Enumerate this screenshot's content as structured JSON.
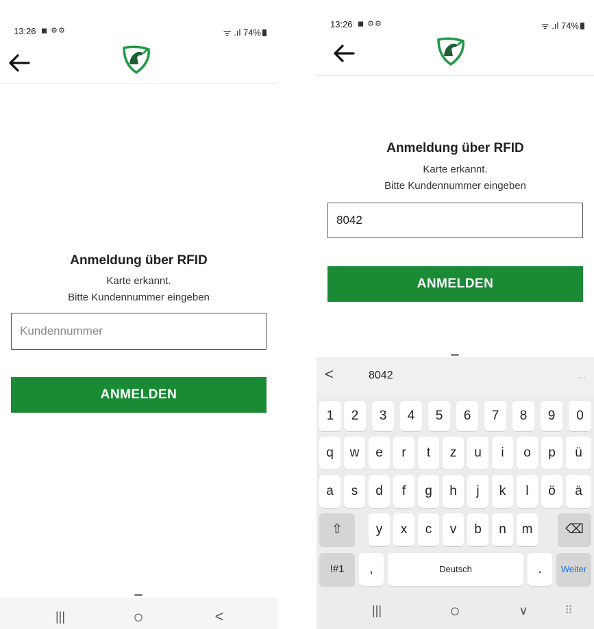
{
  "status_bar": {
    "time": "13:26",
    "notifications": "◼ ⚙⚙",
    "signal": "ᯤ .ıl",
    "battery": "74%"
  },
  "login": {
    "heading": "Anmeldung über RFID",
    "line1": "Karte erkannt.",
    "line2": "Bitte Kundennummer eingeben",
    "placeholder": "Kundennummer",
    "entered_value": "8042",
    "button_label": "ANMELDEN"
  },
  "nav_left": {
    "recents": "|||",
    "home": "○",
    "back": "<"
  },
  "nav_right": {
    "recents": "|||",
    "home": "○",
    "hide": "∨",
    "kb_switch": "⠿"
  },
  "keyboard": {
    "suggestion_back": "<",
    "suggestion": "8042",
    "suggestion_more": "···",
    "row_numbers": [
      "1",
      "2",
      "3",
      "4",
      "5",
      "6",
      "7",
      "8",
      "9",
      "0"
    ],
    "row_1": [
      "q",
      "w",
      "e",
      "r",
      "t",
      "z",
      "u",
      "i",
      "o",
      "p",
      "ü"
    ],
    "row_2": [
      "a",
      "s",
      "d",
      "f",
      "g",
      "h",
      "j",
      "k",
      "l",
      "ö",
      "ä"
    ],
    "row_3": [
      "y",
      "x",
      "c",
      "v",
      "b",
      "n",
      "m"
    ],
    "shift": "⇧",
    "backspace": "⌫",
    "symbols": "!#1",
    "comma": ",",
    "space": "Deutsch",
    "period": ".",
    "enter": "Weiter"
  },
  "colors": {
    "accent_green": "#1a8a35",
    "logo_green": "#1f9a46"
  }
}
